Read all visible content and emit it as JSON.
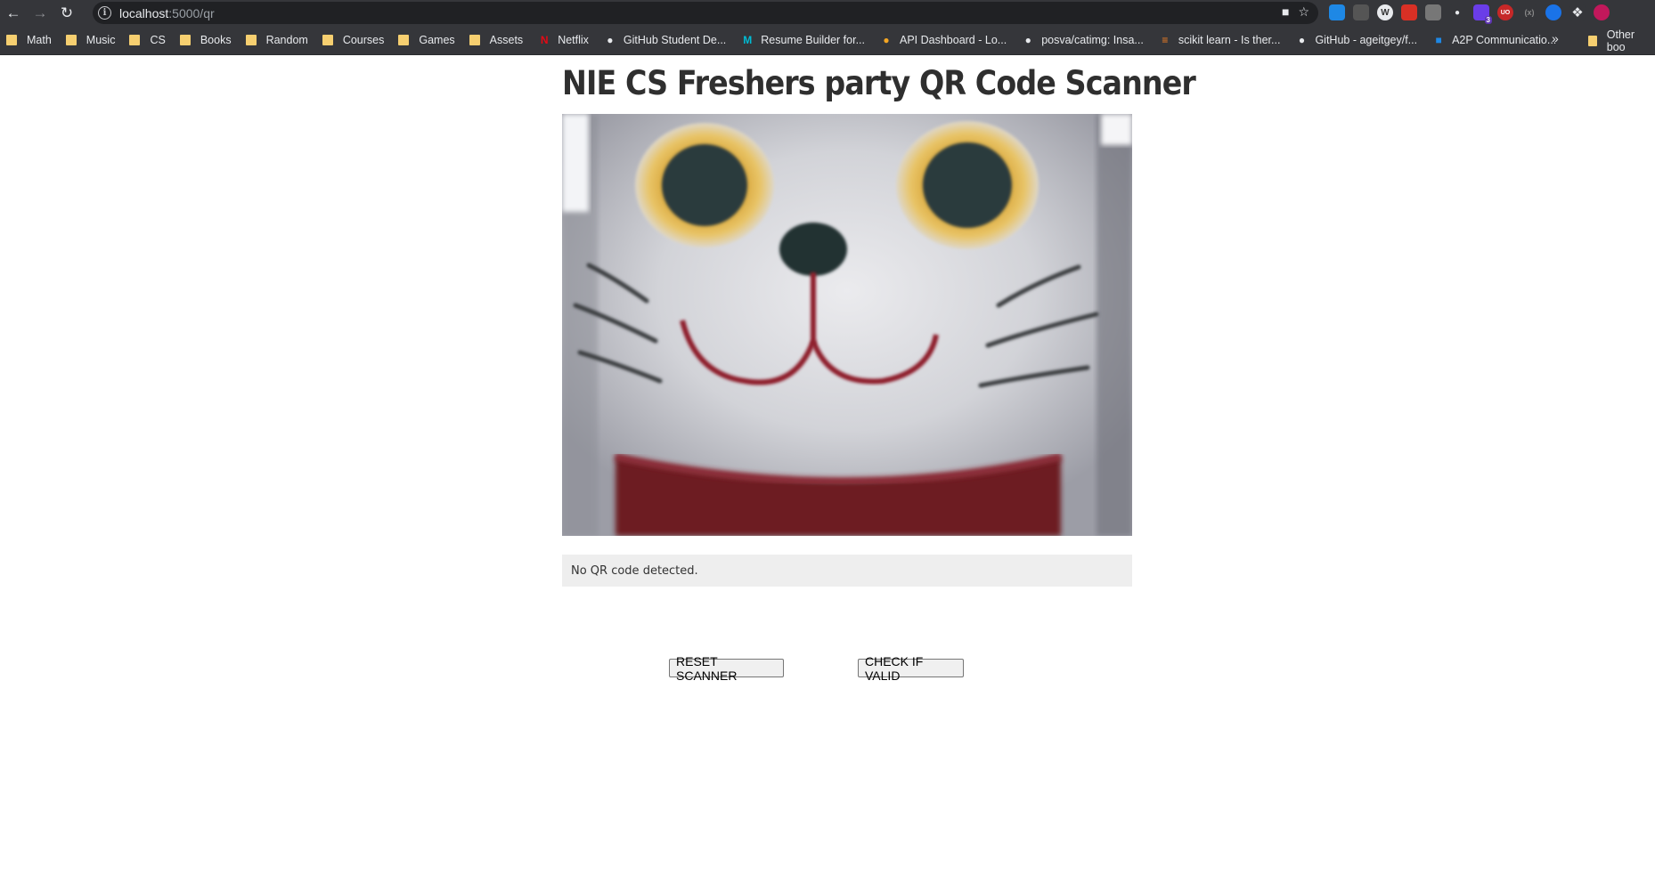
{
  "browser": {
    "url_host": "localhost",
    "url_path": ":5000/qr",
    "bookmarks": [
      {
        "label": "Math",
        "kind": "folder"
      },
      {
        "label": "Music",
        "kind": "folder"
      },
      {
        "label": "CS",
        "kind": "folder"
      },
      {
        "label": "Books",
        "kind": "folder"
      },
      {
        "label": "Random",
        "kind": "folder"
      },
      {
        "label": "Courses",
        "kind": "folder"
      },
      {
        "label": "Games",
        "kind": "folder"
      },
      {
        "label": "Assets",
        "kind": "folder"
      },
      {
        "label": "Netflix",
        "kind": "netflix-icon"
      },
      {
        "label": "GitHub Student De...",
        "kind": "github-icon"
      },
      {
        "label": "Resume Builder for...",
        "kind": "resume-builder-icon"
      },
      {
        "label": "API Dashboard - Lo...",
        "kind": "api-dashboard-icon"
      },
      {
        "label": "posva/catimg: Insa...",
        "kind": "github-icon"
      },
      {
        "label": "scikit learn - Is ther...",
        "kind": "stackoverflow-icon"
      },
      {
        "label": "GitHub - ageitgey/f...",
        "kind": "github-icon"
      },
      {
        "label": "A2P Communicatio...",
        "kind": "azure-icon"
      }
    ],
    "more_label": "»",
    "other_bookmarks": "Other boo",
    "extension_badge": "3"
  },
  "page": {
    "title": "NIE CS Freshers party QR Code Scanner",
    "scan_result": "No QR code detected.",
    "reset_label": "RESET SCANNER",
    "check_label": "CHECK IF VALID"
  },
  "colors": {
    "chrome_bg": "#35363a",
    "omnibox_bg": "#202124",
    "folder": "#f6cf70",
    "message_bg": "#eeeeee"
  }
}
